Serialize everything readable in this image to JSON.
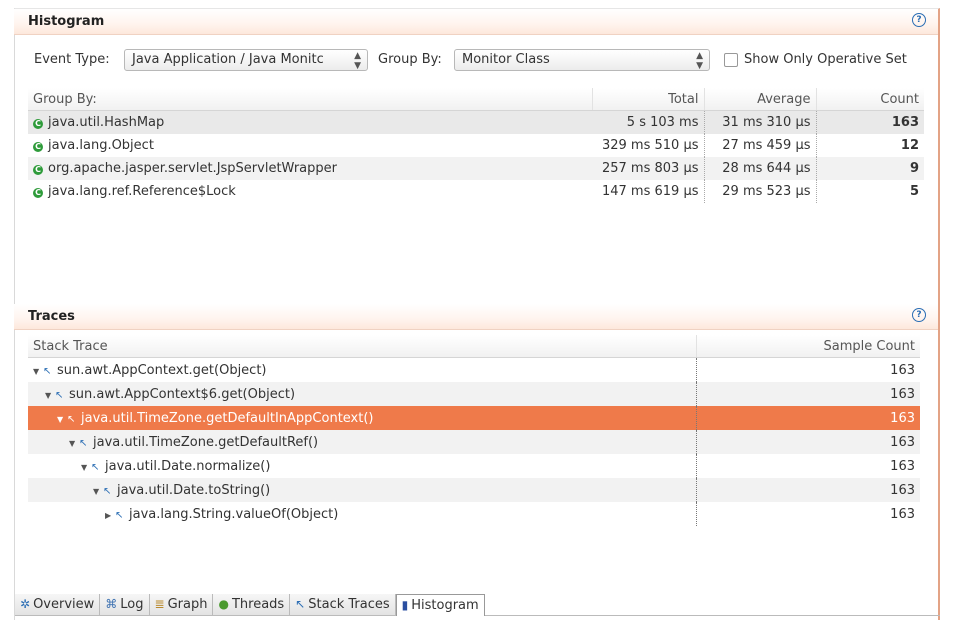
{
  "histogram": {
    "title": "Histogram",
    "event_type_label": "Event Type:",
    "event_type_value": "Java Application / Java Monitc",
    "group_by_label": "Group By:",
    "group_by_value": "Monitor Class",
    "show_operative_label": "Show Only Operative Set",
    "columns": [
      "Group By:",
      "Total",
      "Average",
      "Count"
    ],
    "rows": [
      {
        "name": "java.util.HashMap",
        "total": "5 s 103 ms",
        "average": "31 ms 310 µs",
        "count": "163"
      },
      {
        "name": "java.lang.Object",
        "total": "329 ms 510 µs",
        "average": "27 ms 459 µs",
        "count": "12"
      },
      {
        "name": "org.apache.jasper.servlet.JspServletWrapper",
        "total": "257 ms 803 µs",
        "average": "28 ms 644 µs",
        "count": "9"
      },
      {
        "name": "java.lang.ref.Reference$Lock",
        "total": "147 ms 619 µs",
        "average": "29 ms 523 µs",
        "count": "5"
      }
    ]
  },
  "traces": {
    "title": "Traces",
    "columns": [
      "Stack Trace",
      "Sample Count"
    ],
    "rows": [
      {
        "frame": "sun.awt.AppContext.get(Object)",
        "count": "163",
        "twisty": "▼"
      },
      {
        "frame": "sun.awt.AppContext$6.get(Object)",
        "count": "163",
        "twisty": "▼"
      },
      {
        "frame": "java.util.TimeZone.getDefaultInAppContext()",
        "count": "163",
        "twisty": "▼"
      },
      {
        "frame": "java.util.TimeZone.getDefaultRef()",
        "count": "163",
        "twisty": "▼"
      },
      {
        "frame": "java.util.Date.normalize()",
        "count": "163",
        "twisty": "▼"
      },
      {
        "frame": "java.util.Date.toString()",
        "count": "163",
        "twisty": "▼"
      },
      {
        "frame": "java.lang.String.valueOf(Object)",
        "count": "163",
        "twisty": "▶"
      }
    ]
  },
  "tabs": [
    {
      "label": "Overview",
      "icon": "overview-icon"
    },
    {
      "label": "Log",
      "icon": "log-icon"
    },
    {
      "label": "Graph",
      "icon": "graph-icon"
    },
    {
      "label": "Threads",
      "icon": "threads-icon"
    },
    {
      "label": "Stack Traces",
      "icon": "stack-traces-icon"
    },
    {
      "label": "Histogram",
      "icon": "histogram-icon"
    }
  ],
  "colors": {
    "selection": "#ef7a4a",
    "header_tint": "#fde8dc",
    "accent_blue": "#2a6db4",
    "class_icon_green": "#2e9b3a"
  }
}
